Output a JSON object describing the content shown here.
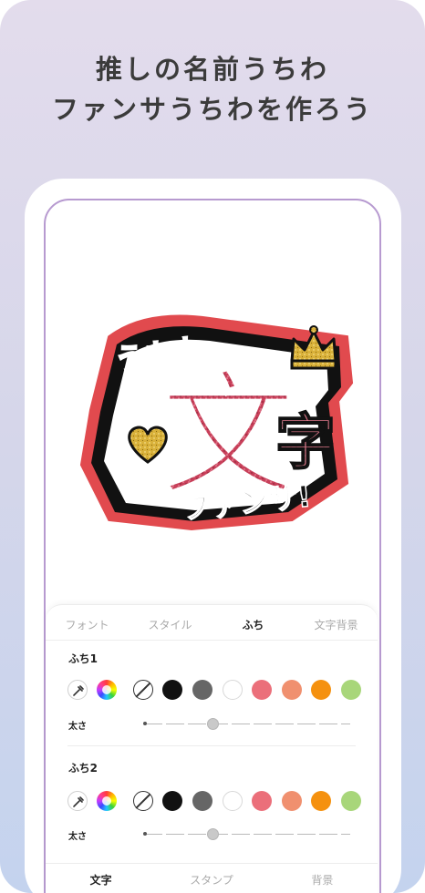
{
  "headline": {
    "line1": "推しの名前うちわ",
    "line2": "ファンサうちわを作ろう"
  },
  "preview": {
    "text_top": "うちわ",
    "text_main": "文",
    "text_side": "字",
    "text_bottom": "ファンサ!",
    "stickers": [
      "crown-icon",
      "heart-icon"
    ]
  },
  "tabs": [
    {
      "label": "フォント",
      "active": false
    },
    {
      "label": "スタイル",
      "active": false
    },
    {
      "label": "ふち",
      "active": true
    },
    {
      "label": "文字背景",
      "active": false
    }
  ],
  "border1": {
    "label": "ふち1",
    "size_label": "太さ",
    "size_value": 0.33
  },
  "border2": {
    "label": "ふち2",
    "size_label": "太さ",
    "size_value": 0.33
  },
  "swatches": [
    "none",
    "#111111",
    "#666666",
    "#ffffff",
    "#eb6f7a",
    "#f0906f",
    "#f5910f",
    "#a8d67a"
  ],
  "bottom_nav": [
    {
      "label": "文字",
      "active": true
    },
    {
      "label": "スタンプ",
      "active": false
    },
    {
      "label": "背景",
      "active": false
    }
  ],
  "colors": {
    "accent_outline": "#b79ad0",
    "glitter_red": "#c8405a",
    "gold": "#d9b13a"
  }
}
